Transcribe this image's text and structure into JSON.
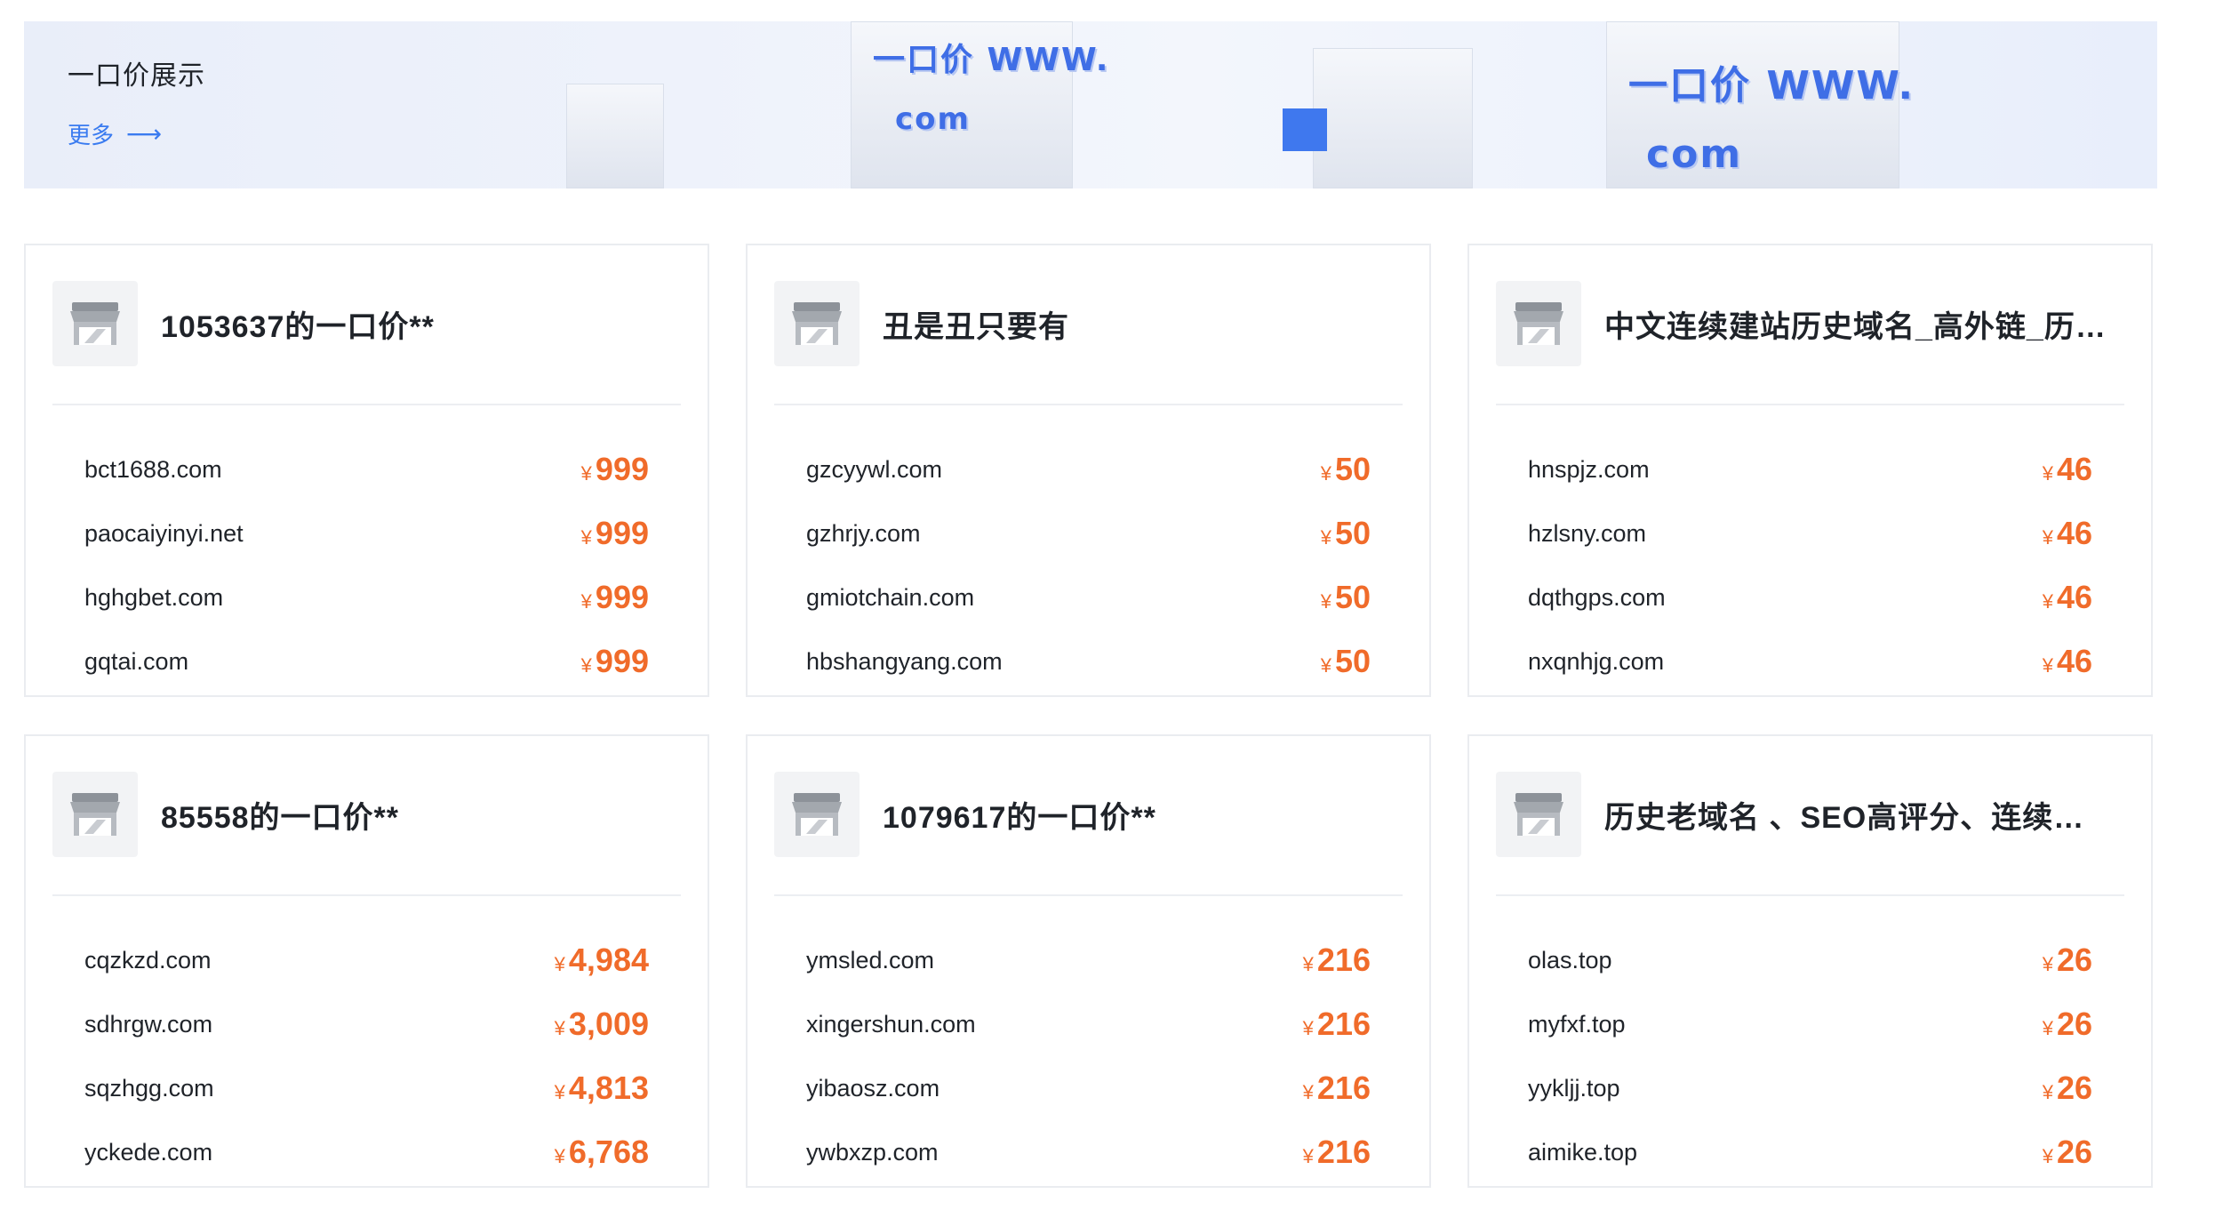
{
  "banner": {
    "title": "一口价展示",
    "more_label": "更多",
    "deco_sign_1_top": "一口价 WWW.",
    "deco_sign_1_bottom": "com",
    "deco_sign_2_top": "一口价 WWW.",
    "deco_sign_2_bottom": "com"
  },
  "currency_symbol": "¥",
  "colors": {
    "price": "#f06b2a",
    "link": "#3a7bf0",
    "banner_bg": "#eaf0fb"
  },
  "cards": [
    {
      "title": "1053637的一口价**",
      "items": [
        {
          "domain": "bct1688.com",
          "price": "999"
        },
        {
          "domain": "paocaiyinyi.net",
          "price": "999"
        },
        {
          "domain": "hghgbet.com",
          "price": "999"
        },
        {
          "domain": "gqtai.com",
          "price": "999"
        }
      ]
    },
    {
      "title": "丑是丑只要有",
      "items": [
        {
          "domain": "gzcyywl.com",
          "price": "50"
        },
        {
          "domain": "gzhrjy.com",
          "price": "50"
        },
        {
          "domain": "gmiotchain.com",
          "price": "50"
        },
        {
          "domain": "hbshangyang.com",
          "price": "50"
        }
      ]
    },
    {
      "title": "中文连续建站历史域名_高外链_历史...",
      "items": [
        {
          "domain": "hnspjz.com",
          "price": "46"
        },
        {
          "domain": "hzlsny.com",
          "price": "46"
        },
        {
          "domain": "dqthgps.com",
          "price": "46"
        },
        {
          "domain": "nxqnhjg.com",
          "price": "46"
        }
      ]
    },
    {
      "title": "85558的一口价**",
      "items": [
        {
          "domain": "cqzkzd.com",
          "price": "4,984"
        },
        {
          "domain": "sdhrgw.com",
          "price": "3,009"
        },
        {
          "domain": "sqzhgg.com",
          "price": "4,813"
        },
        {
          "domain": "yckede.com",
          "price": "6,768"
        }
      ]
    },
    {
      "title": "1079617的一口价**",
      "items": [
        {
          "domain": "ymsled.com",
          "price": "216"
        },
        {
          "domain": "xingershun.com",
          "price": "216"
        },
        {
          "domain": "yibaosz.com",
          "price": "216"
        },
        {
          "domain": "ywbxzp.com",
          "price": "216"
        }
      ]
    },
    {
      "title": "历史老域名 、SEO高评分、连续建站、",
      "items": [
        {
          "domain": "olas.top",
          "price": "26"
        },
        {
          "domain": "myfxf.top",
          "price": "26"
        },
        {
          "domain": "yykljj.top",
          "price": "26"
        },
        {
          "domain": "aimike.top",
          "price": "26"
        }
      ]
    }
  ]
}
